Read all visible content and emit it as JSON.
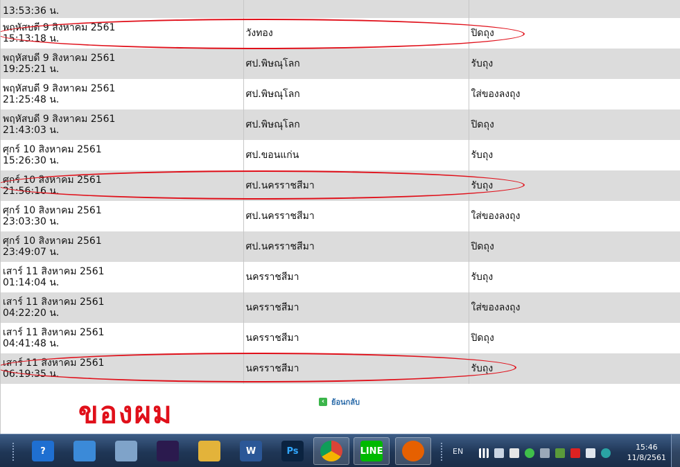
{
  "rows": [
    {
      "date": "",
      "time": "13:53:36 น.",
      "place": "",
      "status": "",
      "shade": true
    },
    {
      "date": "พฤหัสบดี 9 สิงหาคม 2561",
      "time": "15:13:18 น.",
      "place": "วังทอง",
      "status": "ปิดถุง",
      "shade": false
    },
    {
      "date": "พฤหัสบดี 9 สิงหาคม 2561",
      "time": "19:25:21 น.",
      "place": "ศป.พิษณุโลก",
      "status": "รับถุง",
      "shade": true
    },
    {
      "date": "พฤหัสบดี 9 สิงหาคม 2561",
      "time": "21:25:48 น.",
      "place": "ศป.พิษณุโลก",
      "status": "ใส่ของลงถุง",
      "shade": false
    },
    {
      "date": "พฤหัสบดี 9 สิงหาคม 2561",
      "time": "21:43:03 น.",
      "place": "ศป.พิษณุโลก",
      "status": "ปิดถุง",
      "shade": true
    },
    {
      "date": "ศุกร์ 10 สิงหาคม 2561",
      "time": "15:26:30 น.",
      "place": "ศป.ขอนแก่น",
      "status": "รับถุง",
      "shade": false
    },
    {
      "date": "ศุกร์ 10 สิงหาคม 2561",
      "time": "21:56:16 น.",
      "place": "ศป.นครราชสีมา",
      "status": "รับถุง",
      "shade": true
    },
    {
      "date": "ศุกร์ 10 สิงหาคม 2561",
      "time": "23:03:30 น.",
      "place": "ศป.นครราชสีมา",
      "status": "ใส่ของลงถุง",
      "shade": false
    },
    {
      "date": "ศุกร์ 10 สิงหาคม 2561",
      "time": "23:49:07 น.",
      "place": "ศป.นครราชสีมา",
      "status": "ปิดถุง",
      "shade": true
    },
    {
      "date": "เสาร์ 11 สิงหาคม 2561",
      "time": "01:14:04 น.",
      "place": "นครราชสีมา",
      "status": "รับถุง",
      "shade": false
    },
    {
      "date": "เสาร์ 11 สิงหาคม 2561",
      "time": "04:22:20 น.",
      "place": "นครราชสีมา",
      "status": "ใส่ของลงถุง",
      "shade": true
    },
    {
      "date": "เสาร์ 11 สิงหาคม 2561",
      "time": "04:41:48 น.",
      "place": "นครราชสีมา",
      "status": "ปิดถุง",
      "shade": false
    },
    {
      "date": "เสาร์ 11 สิงหาคม 2561",
      "time": "06:19:35 น.",
      "place": "นครราชสีมา",
      "status": "รับถุง",
      "shade": true
    }
  ],
  "back_link": "ย้อนกลับ",
  "annotation_text": "ของผม",
  "taskbar": {
    "apps": [
      {
        "name": "help-app-icon",
        "label": "?",
        "color": "#1f6fd1"
      },
      {
        "name": "photo-viewer-icon",
        "label": "",
        "color": "#3b8ad8"
      },
      {
        "name": "calculator-icon",
        "label": "",
        "color": "#7fa3c9"
      },
      {
        "name": "media-player-icon",
        "label": "",
        "color": "#2b1a4e"
      },
      {
        "name": "file-explorer-icon",
        "label": "",
        "color": "#e3b33a"
      },
      {
        "name": "word-icon",
        "label": "W",
        "color": "#2b5797"
      },
      {
        "name": "photoshop-icon",
        "label": "Ps",
        "color": "#0b2340"
      },
      {
        "name": "chrome-icon",
        "label": "",
        "color": "#ffffff"
      },
      {
        "name": "line-icon",
        "label": "LINE",
        "color": "#00b900"
      },
      {
        "name": "firefox-icon",
        "label": "",
        "color": "#e66000"
      }
    ],
    "language": "EN",
    "time": "15:46",
    "date": "11/8/2561"
  },
  "colors": {
    "highlight": "#e0101a",
    "row_shade": "#dcdcdc"
  }
}
